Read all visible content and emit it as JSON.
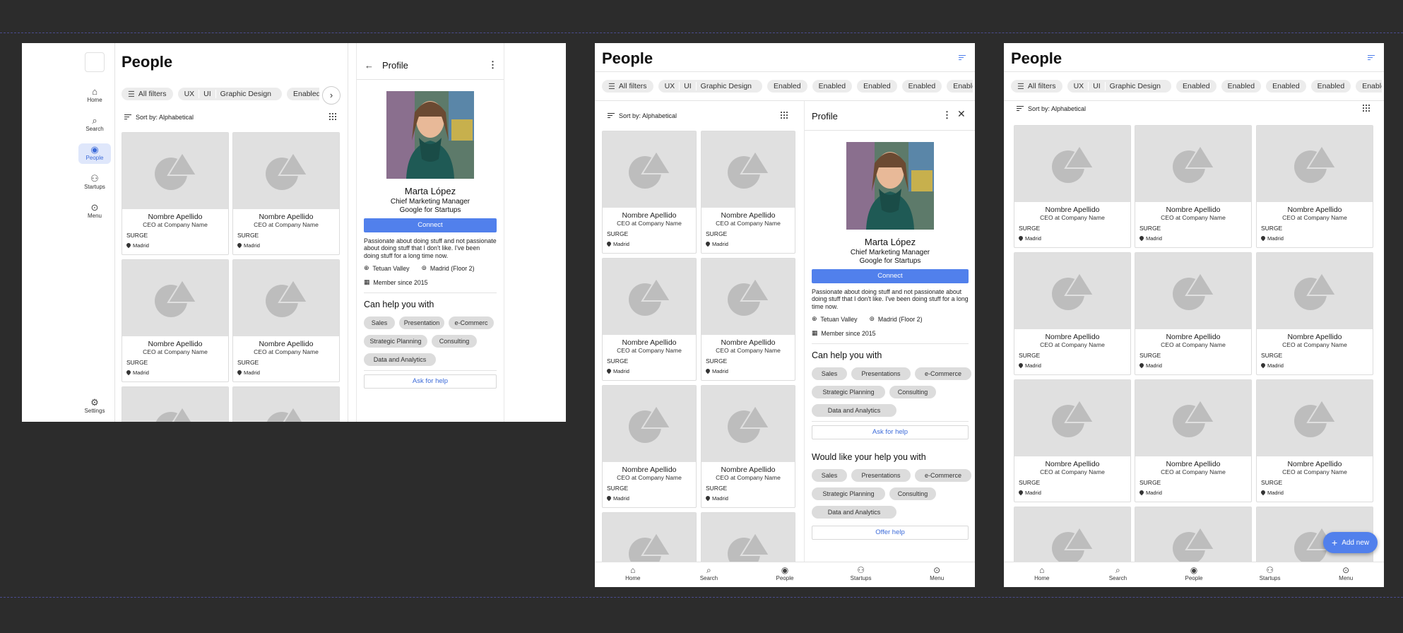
{
  "colors": {
    "background": "#2c2c2c",
    "accent": "#5180ec",
    "chip": "#ececec",
    "placeholder": "#e0e0e0"
  },
  "page": {
    "title": "People"
  },
  "filters": {
    "all_filters": "All filters",
    "tags": [
      "UX",
      "UI",
      "Graphic Design"
    ],
    "enabled": "Enabled"
  },
  "sort": {
    "label": "Sort by: Alphabetical"
  },
  "card": {
    "name": "Nombre Apellido",
    "role": "CEO at Company Name",
    "company": "SURGE",
    "location": "Madrid"
  },
  "sidenav": [
    {
      "label": "Home",
      "icon": "home-icon"
    },
    {
      "label": "Search",
      "icon": "search-icon"
    },
    {
      "label": "People",
      "icon": "person-icon"
    },
    {
      "label": "Startups",
      "icon": "group-icon"
    },
    {
      "label": "Menu",
      "icon": "more-circle-icon"
    }
  ],
  "settings": {
    "label": "Settings",
    "icon": "gear-icon"
  },
  "bottomnav": [
    {
      "label": "Home",
      "icon": "home-icon"
    },
    {
      "label": "Search",
      "icon": "search-icon"
    },
    {
      "label": "People",
      "icon": "person-icon"
    },
    {
      "label": "Startups",
      "icon": "group-icon"
    },
    {
      "label": "Menu",
      "icon": "more-circle-icon"
    }
  ],
  "profile": {
    "title": "Profile",
    "name": "Marta López",
    "position": "Chief Marketing Manager",
    "company": "Google for Startups",
    "connect": "Connect",
    "bio": "Passionate about doing stuff and not passionate about doing stuff that I don't like. I've been doing stuff for a long time now.",
    "org": "Tetuan Valley",
    "office": "Madrid (Floor 2)",
    "member": "Member since 2015",
    "can_help_title": "Can help you with",
    "can_help_tags_narrow": [
      "Sales",
      "Presentation",
      "e-Commerc",
      "Strategic Planning",
      "Consulting",
      "Data and Analytics"
    ],
    "can_help_tags": [
      "Sales",
      "Presentations",
      "e-Commerce",
      "Strategic Planning",
      "Consulting",
      "Data and Analytics"
    ],
    "ask_help": "Ask for help",
    "would_like_title": "Would like your help you with",
    "would_like_tags": [
      "Sales",
      "Presentations",
      "e-Commerce",
      "Strategic Planning",
      "Consulting",
      "Data and Analytics"
    ],
    "offer_help": "Offer help"
  },
  "fab": {
    "label": "Add new"
  }
}
